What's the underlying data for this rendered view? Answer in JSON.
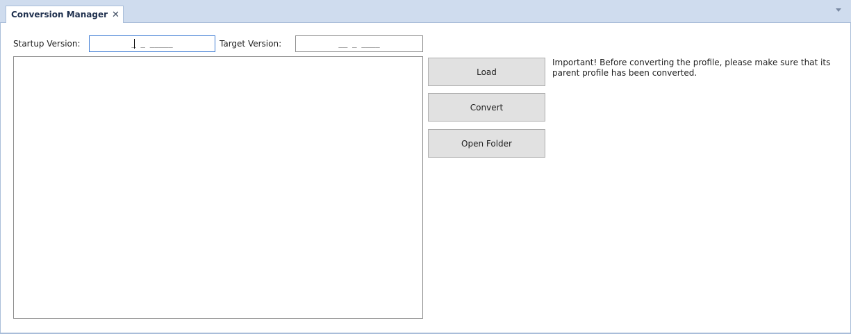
{
  "tab": {
    "title": "Conversion Manager",
    "close_glyph": "✕"
  },
  "form": {
    "startup_label": "Startup Version:",
    "startup_value": "_ _ _____",
    "target_label": "Target Version:",
    "target_value": "__ _ ____"
  },
  "buttons": {
    "load": "Load",
    "convert": "Convert",
    "open_folder": "Open Folder"
  },
  "notice": "Important! Before converting the profile, please make sure that its parent profile has been converted.",
  "icons": {
    "tab_close": "close-icon",
    "tab_menu": "chevron-down-icon"
  },
  "colors": {
    "tabstrip_bg": "#cfdcee",
    "border": "#a9bdd9",
    "focus_border": "#3d7bd4",
    "button_bg": "#e1e1e1"
  }
}
